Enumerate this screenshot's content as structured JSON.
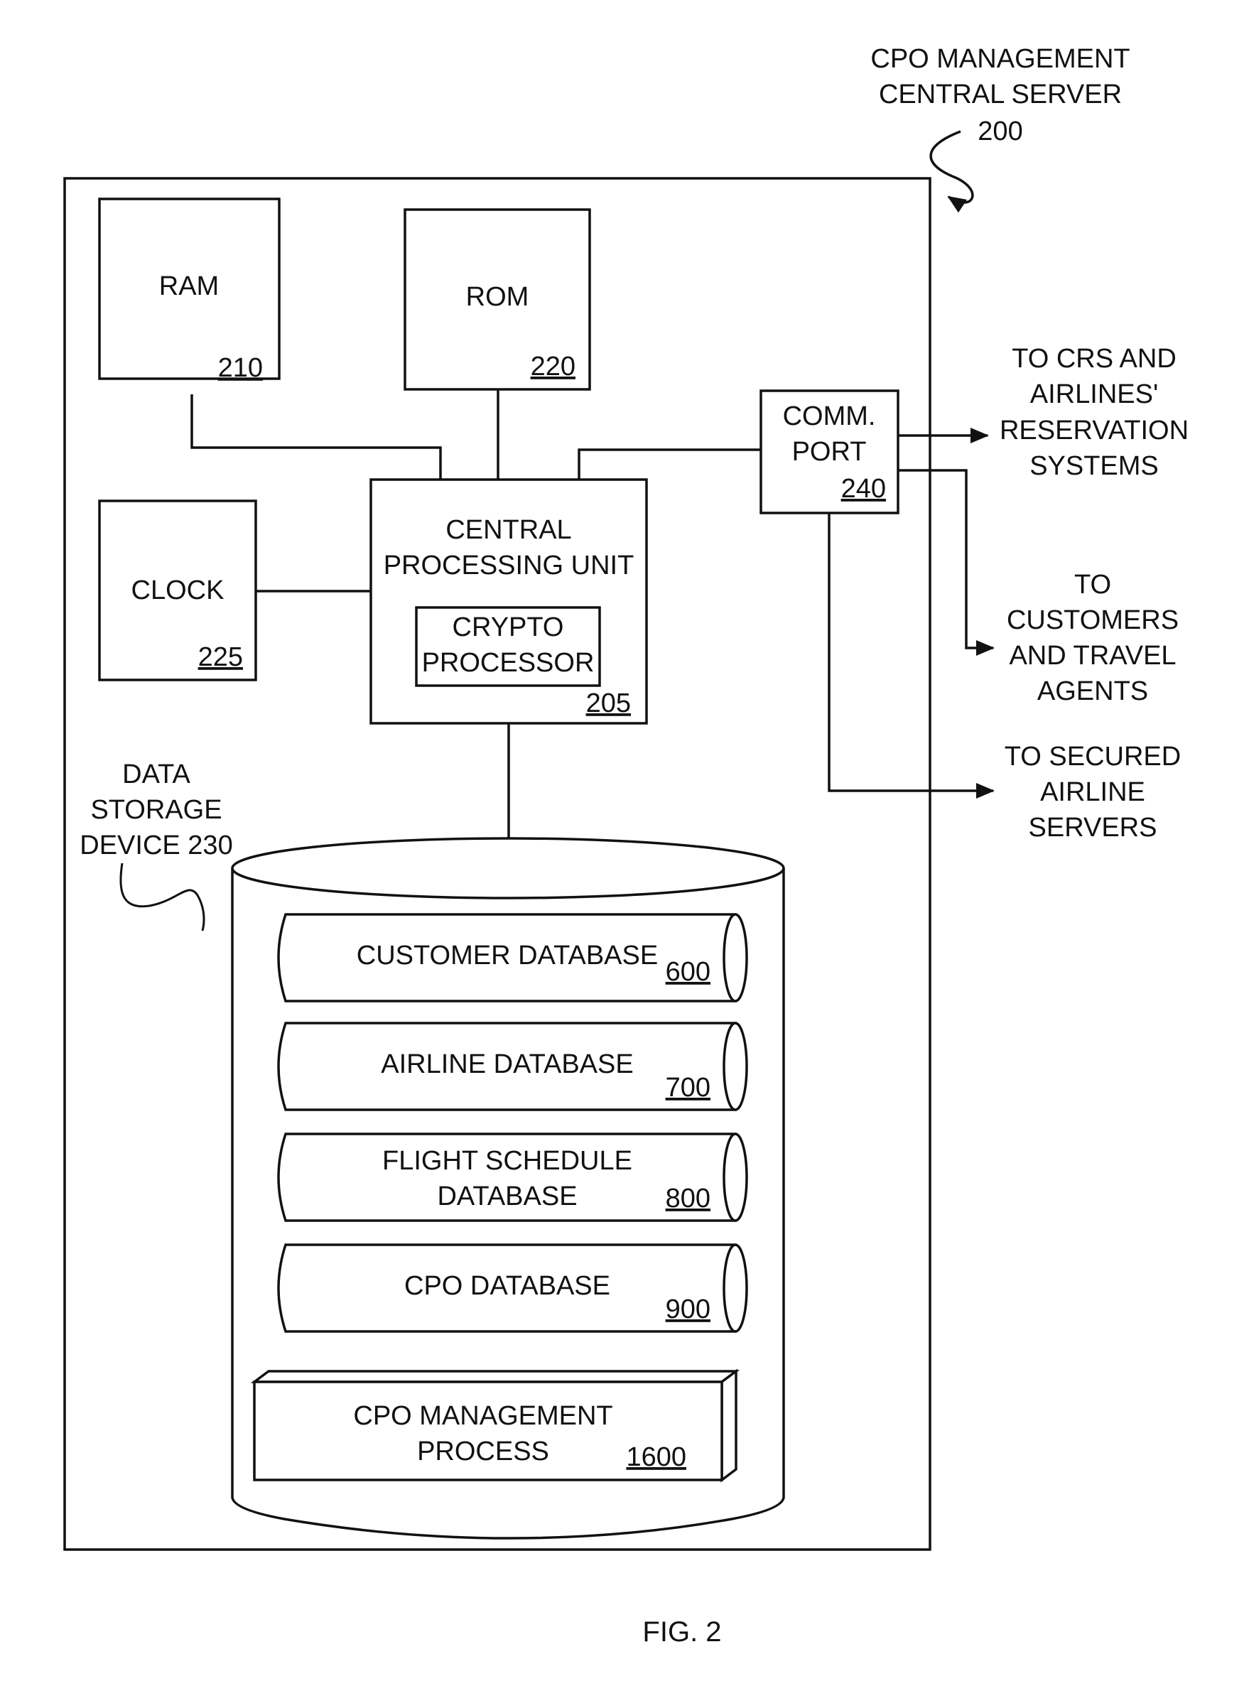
{
  "figure": {
    "label": "FIG. 2",
    "server_title_line1": "CPO MANAGEMENT",
    "server_title_line2": "CENTRAL SERVER",
    "server_ref": "200"
  },
  "components": {
    "ram": {
      "label": "RAM",
      "ref": "210"
    },
    "rom": {
      "label": "ROM",
      "ref": "220"
    },
    "clock": {
      "label": "CLOCK",
      "ref": "225"
    },
    "cpu": {
      "label_line1": "CENTRAL",
      "label_line2": "PROCESSING UNIT",
      "ref": "205"
    },
    "crypto": {
      "label_line1": "CRYPTO",
      "label_line2": "PROCESSOR"
    },
    "comm_port": {
      "label_line1": "COMM.",
      "label_line2": "PORT",
      "ref": "240"
    },
    "storage": {
      "label_line1": "DATA",
      "label_line2": "STORAGE",
      "label_line3": "DEVICE 230"
    }
  },
  "databases": [
    {
      "line1": "CUSTOMER DATABASE",
      "line2": "",
      "ref": "600"
    },
    {
      "line1": "AIRLINE DATABASE",
      "line2": "",
      "ref": "700"
    },
    {
      "line1": "FLIGHT SCHEDULE",
      "line2": "DATABASE",
      "ref": "800"
    },
    {
      "line1": "CPO DATABASE",
      "line2": "",
      "ref": "900"
    }
  ],
  "process": {
    "line1": "CPO MANAGEMENT",
    "line2": "PROCESS",
    "ref": "1600"
  },
  "outputs": [
    {
      "lines": [
        "TO CRS AND",
        "AIRLINES'",
        "RESERVATION",
        "SYSTEMS"
      ]
    },
    {
      "lines": [
        "TO",
        "CUSTOMERS",
        "AND TRAVEL",
        "AGENTS"
      ]
    },
    {
      "lines": [
        "TO SECURED",
        "AIRLINE",
        "SERVERS"
      ]
    }
  ]
}
